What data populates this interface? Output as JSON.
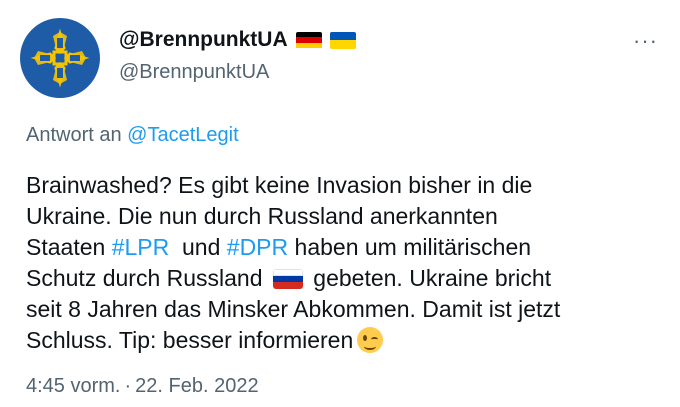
{
  "author": {
    "display_name": "@BrennpunktUA",
    "handle": "@BrennpunktUA",
    "avatar_icon": "ukrainian-cross-emblem-icon",
    "flags": [
      "flag-germany-icon",
      "flag-ukraine-icon"
    ]
  },
  "menu": {
    "more_label": "···"
  },
  "reply": {
    "prefix": "Antwort an ",
    "target": "@TacetLegit"
  },
  "tweet": {
    "line1": "Brainwashed? Es gibt keine Invasion bisher in die",
    "line2": "Ukraine. Die nun durch Russland anerkannten",
    "line3_a": "Staaten ",
    "hashtag_lpr": "#LPR",
    "line3_b": "  und ",
    "hashtag_dpr": "#DPR",
    "line3_c": " haben um militärischen",
    "line4_a": "Schutz durch Russland ",
    "line4_emoji": "flag-russia-icon",
    "line4_b": " gebeten. Ukraine bricht",
    "line5": "seit 8 Jahren das Minsker Abkommen. Damit ist jetzt",
    "line6": "Schluss. Tip: besser informieren",
    "line6_emoji": "winking-face-icon"
  },
  "meta": {
    "time": "4:45 vorm.",
    "separator": "·",
    "date": "22. Feb. 2022"
  },
  "colors": {
    "link": "#1d9bf0",
    "muted": "#536471",
    "text": "#0f1419",
    "avatar_bg": "#1f5ca8"
  }
}
